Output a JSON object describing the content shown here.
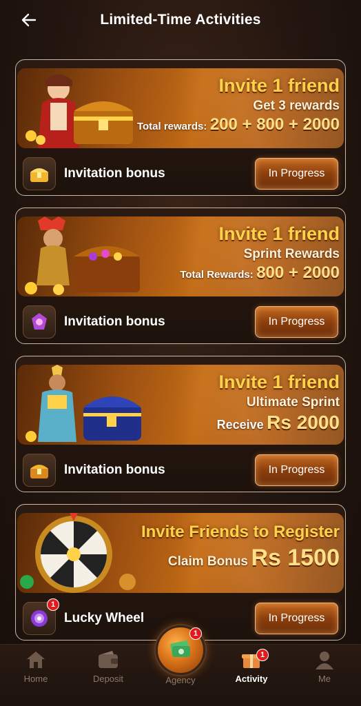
{
  "header": {
    "title": "Limited-Time Activities"
  },
  "cards": [
    {
      "banner": {
        "title": "Invite 1 friend",
        "subtitle": "Get 3 rewards",
        "line_label": "Total rewards:",
        "line_value": "200 + 800 + 2000"
      },
      "footer": {
        "label": "Invitation bonus",
        "button": "In Progress"
      }
    },
    {
      "banner": {
        "title": "Invite 1 friend",
        "subtitle": "Sprint Rewards",
        "line_label": "Total Rewards:",
        "line_value": "800 + 2000"
      },
      "footer": {
        "label": "Invitation bonus",
        "button": "In Progress"
      }
    },
    {
      "banner": {
        "title": "Invite 1 friend",
        "subtitle": "Ultimate Sprint",
        "line_label": "Receive",
        "line_value": "Rs 2000"
      },
      "footer": {
        "label": "Invitation bonus",
        "button": "In Progress"
      }
    },
    {
      "banner": {
        "title": "Invite Friends to Register",
        "line_label": "Claim Bonus",
        "line_value": "Rs 1500"
      },
      "footer": {
        "label": "Lucky Wheel",
        "button": "In Progress",
        "badge": "1"
      }
    }
  ],
  "tabbar": {
    "home": "Home",
    "deposit": "Deposit",
    "agency": "Agency",
    "agency_badge": "1",
    "activity": "Activity",
    "activity_badge": "1",
    "me": "Me"
  },
  "colors": {
    "accent": "#ffd24a",
    "button": "#c46a20",
    "badge": "#e11b1b"
  }
}
